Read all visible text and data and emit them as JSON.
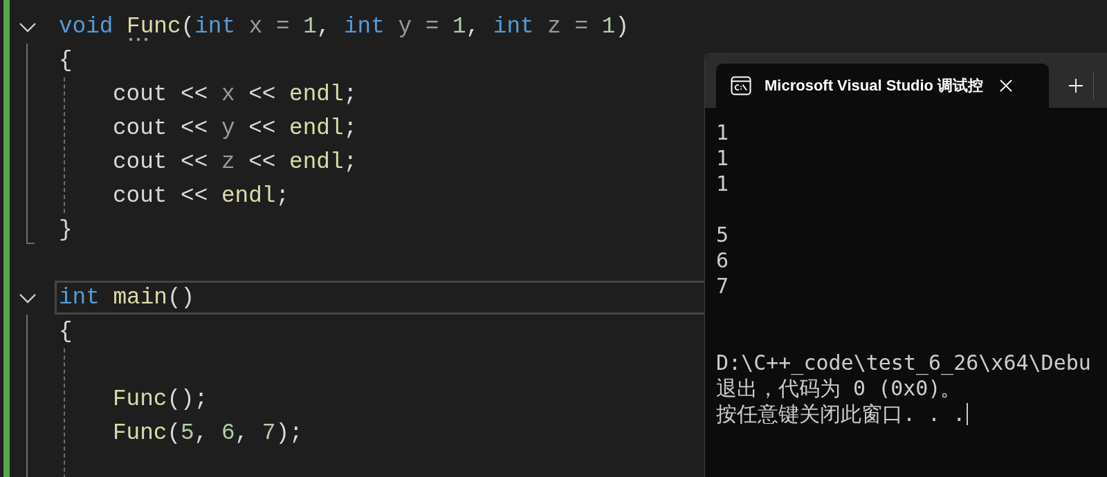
{
  "editor": {
    "functions": [
      {
        "expanded": true,
        "current": false,
        "signature": [
          {
            "text": "void ",
            "kind": "keyword"
          },
          {
            "text": "Func",
            "kind": "function"
          },
          {
            "text": "(",
            "kind": "plain"
          },
          {
            "text": "int",
            "kind": "keyword"
          },
          {
            "text": " x = ",
            "kind": "param"
          },
          {
            "text": "1",
            "kind": "number"
          },
          {
            "text": ", ",
            "kind": "plain"
          },
          {
            "text": "int",
            "kind": "keyword"
          },
          {
            "text": " y = ",
            "kind": "param"
          },
          {
            "text": "1",
            "kind": "number"
          },
          {
            "text": ", ",
            "kind": "plain"
          },
          {
            "text": "int",
            "kind": "keyword"
          },
          {
            "text": " z = ",
            "kind": "param"
          },
          {
            "text": "1",
            "kind": "number"
          },
          {
            "text": ")",
            "kind": "plain"
          }
        ],
        "open_brace": "{",
        "body": [
          {
            "blank_before": false,
            "tokens": [
              {
                "text": "cout << ",
                "kind": "plain"
              },
              {
                "text": "x",
                "kind": "param"
              },
              {
                "text": " << ",
                "kind": "plain"
              },
              {
                "text": "endl",
                "kind": "function"
              },
              {
                "text": ";",
                "kind": "plain"
              }
            ]
          },
          {
            "blank_before": false,
            "tokens": [
              {
                "text": "cout << ",
                "kind": "plain"
              },
              {
                "text": "y",
                "kind": "param"
              },
              {
                "text": " << ",
                "kind": "plain"
              },
              {
                "text": "endl",
                "kind": "function"
              },
              {
                "text": ";",
                "kind": "plain"
              }
            ]
          },
          {
            "blank_before": false,
            "tokens": [
              {
                "text": "cout << ",
                "kind": "plain"
              },
              {
                "text": "z",
                "kind": "param"
              },
              {
                "text": " << ",
                "kind": "plain"
              },
              {
                "text": "endl",
                "kind": "function"
              },
              {
                "text": ";",
                "kind": "plain"
              }
            ]
          },
          {
            "blank_before": false,
            "tokens": [
              {
                "text": "cout << ",
                "kind": "plain"
              },
              {
                "text": "endl",
                "kind": "function"
              },
              {
                "text": ";",
                "kind": "plain"
              }
            ]
          }
        ],
        "close_brace": "}"
      },
      {
        "expanded": true,
        "current": true,
        "signature": [
          {
            "text": "int ",
            "kind": "keyword"
          },
          {
            "text": "main",
            "kind": "function"
          },
          {
            "text": "()",
            "kind": "plain"
          }
        ],
        "open_brace": "{",
        "body": [
          {
            "blank_before": true,
            "tokens": [
              {
                "text": "Func",
                "kind": "function"
              },
              {
                "text": "();",
                "kind": "plain"
              }
            ]
          },
          {
            "blank_before": false,
            "tokens": [
              {
                "text": "Func",
                "kind": "function"
              },
              {
                "text": "(",
                "kind": "plain"
              },
              {
                "text": "5",
                "kind": "number"
              },
              {
                "text": ", ",
                "kind": "plain"
              },
              {
                "text": "6",
                "kind": "number"
              },
              {
                "text": ", ",
                "kind": "plain"
              },
              {
                "text": "7",
                "kind": "number"
              },
              {
                "text": ");",
                "kind": "plain"
              }
            ]
          }
        ]
      }
    ]
  },
  "console": {
    "tab": {
      "title": "Microsoft Visual Studio 调试控",
      "selected": true
    },
    "output_groups": [
      [
        "1",
        "1",
        "1"
      ],
      [
        "5",
        "6",
        "7"
      ]
    ],
    "exit_message": [
      "D:\\C++_code\\test_6_26\\x64\\Debu",
      "退出，代码为 0 (0x0)。",
      "按任意键关闭此窗口. . ."
    ]
  }
}
